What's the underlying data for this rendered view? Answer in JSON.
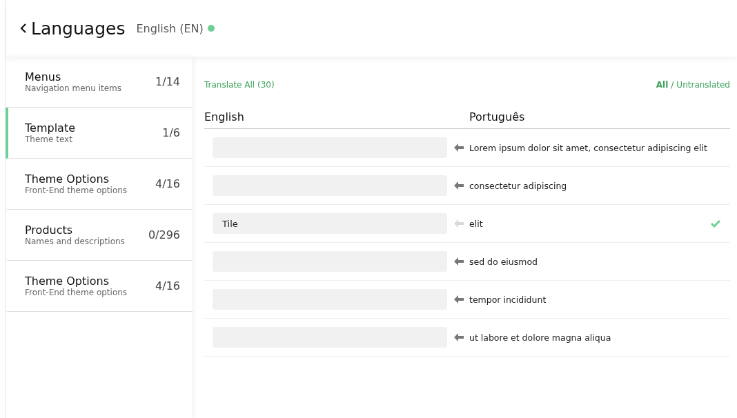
{
  "header": {
    "title": "Languages",
    "language": "English (EN)",
    "online": true
  },
  "sidebar": {
    "items": [
      {
        "title": "Menus",
        "subtitle": "Navigation menu items",
        "count": "1/14",
        "selected": false
      },
      {
        "title": "Template",
        "subtitle": "Theme text",
        "count": "1/6",
        "selected": true
      },
      {
        "title": "Theme Options",
        "subtitle": "Front-End theme options",
        "count": "4/16",
        "selected": false
      },
      {
        "title": "Products",
        "subtitle": "Names and descriptions",
        "count": "0/296",
        "selected": false
      },
      {
        "title": "Theme Options",
        "subtitle": "Front-End theme options",
        "count": "4/16",
        "selected": false
      }
    ]
  },
  "toolbar": {
    "translate_all": "Translate All (30)",
    "filters": [
      {
        "label": "All",
        "selected": true
      },
      {
        "label": "Untranslated",
        "selected": false
      }
    ],
    "separator": "/"
  },
  "table": {
    "columns": [
      "English",
      "Português"
    ],
    "rows": [
      {
        "value": "",
        "source": "Lorem ipsum dolor sit amet, consectetur adipiscing elit",
        "translated": false
      },
      {
        "value": "",
        "source": "consectetur adipiscing",
        "translated": false
      },
      {
        "value": "Tile",
        "source": "elit",
        "translated": true
      },
      {
        "value": "",
        "source": "sed do eiusmod",
        "translated": false
      },
      {
        "value": "",
        "source": "tempor incididunt",
        "translated": false
      },
      {
        "value": "",
        "source": "ut labore et dolore magna aliqua",
        "translated": false
      }
    ]
  }
}
